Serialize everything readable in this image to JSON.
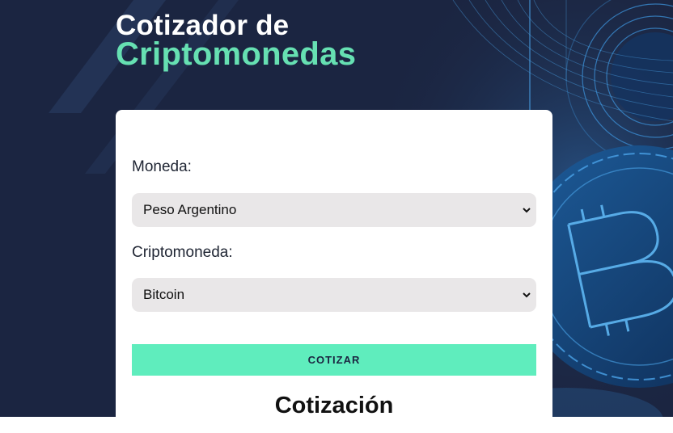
{
  "header": {
    "title_line1": "Cotizador de",
    "title_line2": "Criptomonedas"
  },
  "form": {
    "currency_label": "Moneda:",
    "currency_selected": "Peso Argentino",
    "crypto_label": "Criptomoneda:",
    "crypto_selected": "Bitcoin",
    "submit_label": "COTIZAR"
  },
  "result": {
    "title": "Cotización"
  },
  "colors": {
    "background": "#1b2541",
    "accent": "#66e0b2",
    "button": "#5fedbd",
    "select_bg": "#e9e7e8"
  },
  "icons": {
    "select_arrow": "chevron-down-icon",
    "background_art": "bitcoin-coin-illustration"
  }
}
